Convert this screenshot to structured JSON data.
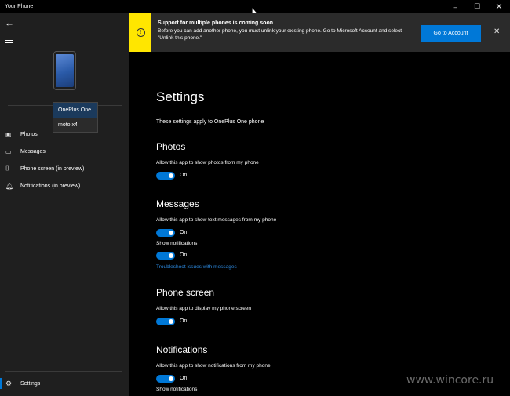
{
  "window": {
    "title": "Your Phone",
    "controls": {
      "minimize": "–",
      "maximize": "☐",
      "close": "✕"
    }
  },
  "sidebar": {
    "back_icon": "←",
    "menu_icon": "hamburger-icon",
    "device_dropdown": {
      "options": [
        "OnePlus One",
        "moto x4"
      ],
      "selected": "OnePlus One"
    },
    "nav_items": [
      {
        "label": "Photos",
        "icon": "photos-icon",
        "glyph": "▣"
      },
      {
        "label": "Messages",
        "icon": "messages-icon",
        "glyph": "▭"
      },
      {
        "label": "Phone screen (in preview)",
        "icon": "phone-screen-icon",
        "glyph": "⌷"
      },
      {
        "label": "Notifications (in preview)",
        "icon": "bell-icon",
        "glyph": "🔔︎"
      }
    ],
    "settings_label": "Settings",
    "settings_glyph": "⚙"
  },
  "banner": {
    "title": "Support for multiple phones is coming soon",
    "body": "Before you can add another phone, you must unlink your existing phone. Go to Microsoft Account and select \"Unlink this phone.\"",
    "warn_glyph": "!",
    "button_label": "Go to Account",
    "dismiss_glyph": "✕",
    "accent_color": "#ffe600"
  },
  "main": {
    "title": "Settings",
    "subtitle": "These settings apply to OnePlus One phone",
    "sections": {
      "photos": {
        "heading": "Photos",
        "allow_label": "Allow this app to show photos from my phone",
        "allow_state": "On"
      },
      "messages": {
        "heading": "Messages",
        "allow_label": "Allow this app to show text messages from my phone",
        "allow_state": "On",
        "notif_label": "Show notifications",
        "notif_state": "On",
        "troubleshoot_link": "Troubleshoot issues with messages"
      },
      "phone_screen": {
        "heading": "Phone screen",
        "allow_label": "Allow this app to display my phone screen",
        "allow_state": "On"
      },
      "notifications": {
        "heading": "Notifications",
        "allow_label": "Allow this app to show notifications from my phone",
        "allow_state": "On",
        "notif_label": "Show notifications"
      }
    }
  },
  "watermark": "www.wincore.ru",
  "colors": {
    "accent": "#0078d7",
    "link": "#2d8ae0"
  }
}
